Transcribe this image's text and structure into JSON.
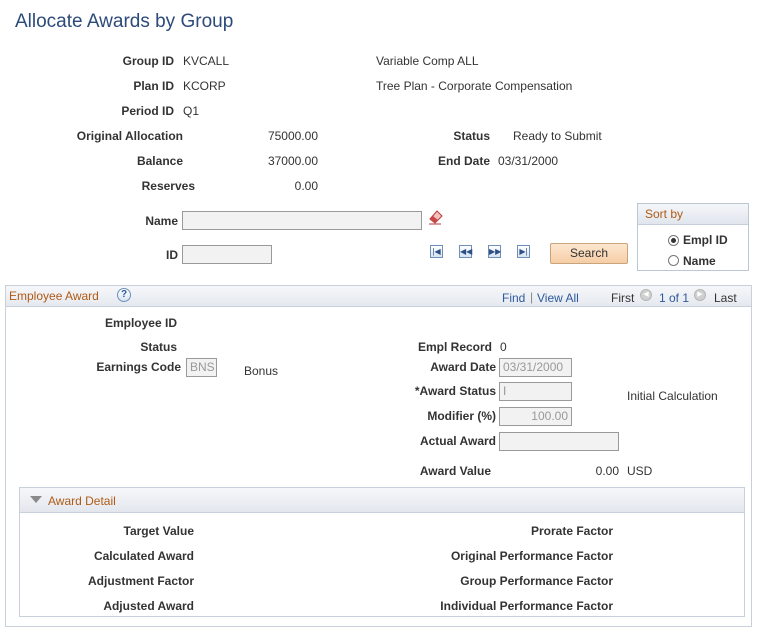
{
  "page": {
    "title": "Allocate Awards by Group"
  },
  "header": {
    "group_id_label": "Group ID",
    "group_id": "KVCALL",
    "group_desc": "Variable Comp ALL",
    "plan_id_label": "Plan ID",
    "plan_id": "KCORP",
    "plan_desc": "Tree Plan - Corporate Compensation",
    "period_id_label": "Period ID",
    "period_id": "Q1",
    "original_allocation_label": "Original Allocation",
    "original_allocation": "75000.00",
    "status_label": "Status",
    "status": "Ready to Submit",
    "balance_label": "Balance",
    "balance": "37000.00",
    "end_date_label": "End Date",
    "end_date": "03/31/2000",
    "reserves_label": "Reserves",
    "reserves": "0.00"
  },
  "search": {
    "name_label": "Name",
    "name_value": "",
    "id_label": "ID",
    "id_value": "",
    "search_button": "Search"
  },
  "sort": {
    "title": "Sort by",
    "options": [
      "Empl ID",
      "Name"
    ],
    "selected": "Empl ID"
  },
  "employee_award": {
    "title": "Employee Award",
    "help": "?",
    "find": "Find",
    "separator": "|",
    "view_all": "View All",
    "first": "First",
    "range": "1 of 1",
    "last": "Last",
    "employee_id_label": "Employee ID",
    "status_label": "Status",
    "empl_record_label": "Empl Record",
    "empl_record": "0",
    "earnings_code_label": "Earnings Code",
    "earnings_code": "BNS",
    "earnings_desc": "Bonus",
    "award_date_label": "Award Date",
    "award_date": "03/31/2000",
    "award_status_label": "*Award Status",
    "award_status": "I",
    "award_status_desc": "Initial Calculation",
    "modifier_label": "Modifier (%)",
    "modifier": "100.00",
    "actual_award_label": "Actual Award",
    "actual_award": "",
    "award_value_label": "Award Value",
    "award_value": "0.00",
    "currency": "USD"
  },
  "award_detail": {
    "title": "Award Detail",
    "target_value_label": "Target Value",
    "calculated_award_label": "Calculated Award",
    "adjustment_factor_label": "Adjustment Factor",
    "adjusted_award_label": "Adjusted Award",
    "prorate_factor_label": "Prorate Factor",
    "original_performance_label": "Original Performance Factor",
    "group_performance_label": "Group Performance Factor",
    "individual_performance_label": "Individual Performance Factor"
  },
  "icons": {
    "eraser": "eraser-icon",
    "first": "first-page-icon",
    "prev": "previous-icon",
    "next": "next-icon",
    "last": "last-page-icon",
    "collapse": "collapse-triangle-icon"
  },
  "colors": {
    "title": "#2c4a7a",
    "section_title": "#b15a14",
    "link": "#2d5a9e"
  }
}
